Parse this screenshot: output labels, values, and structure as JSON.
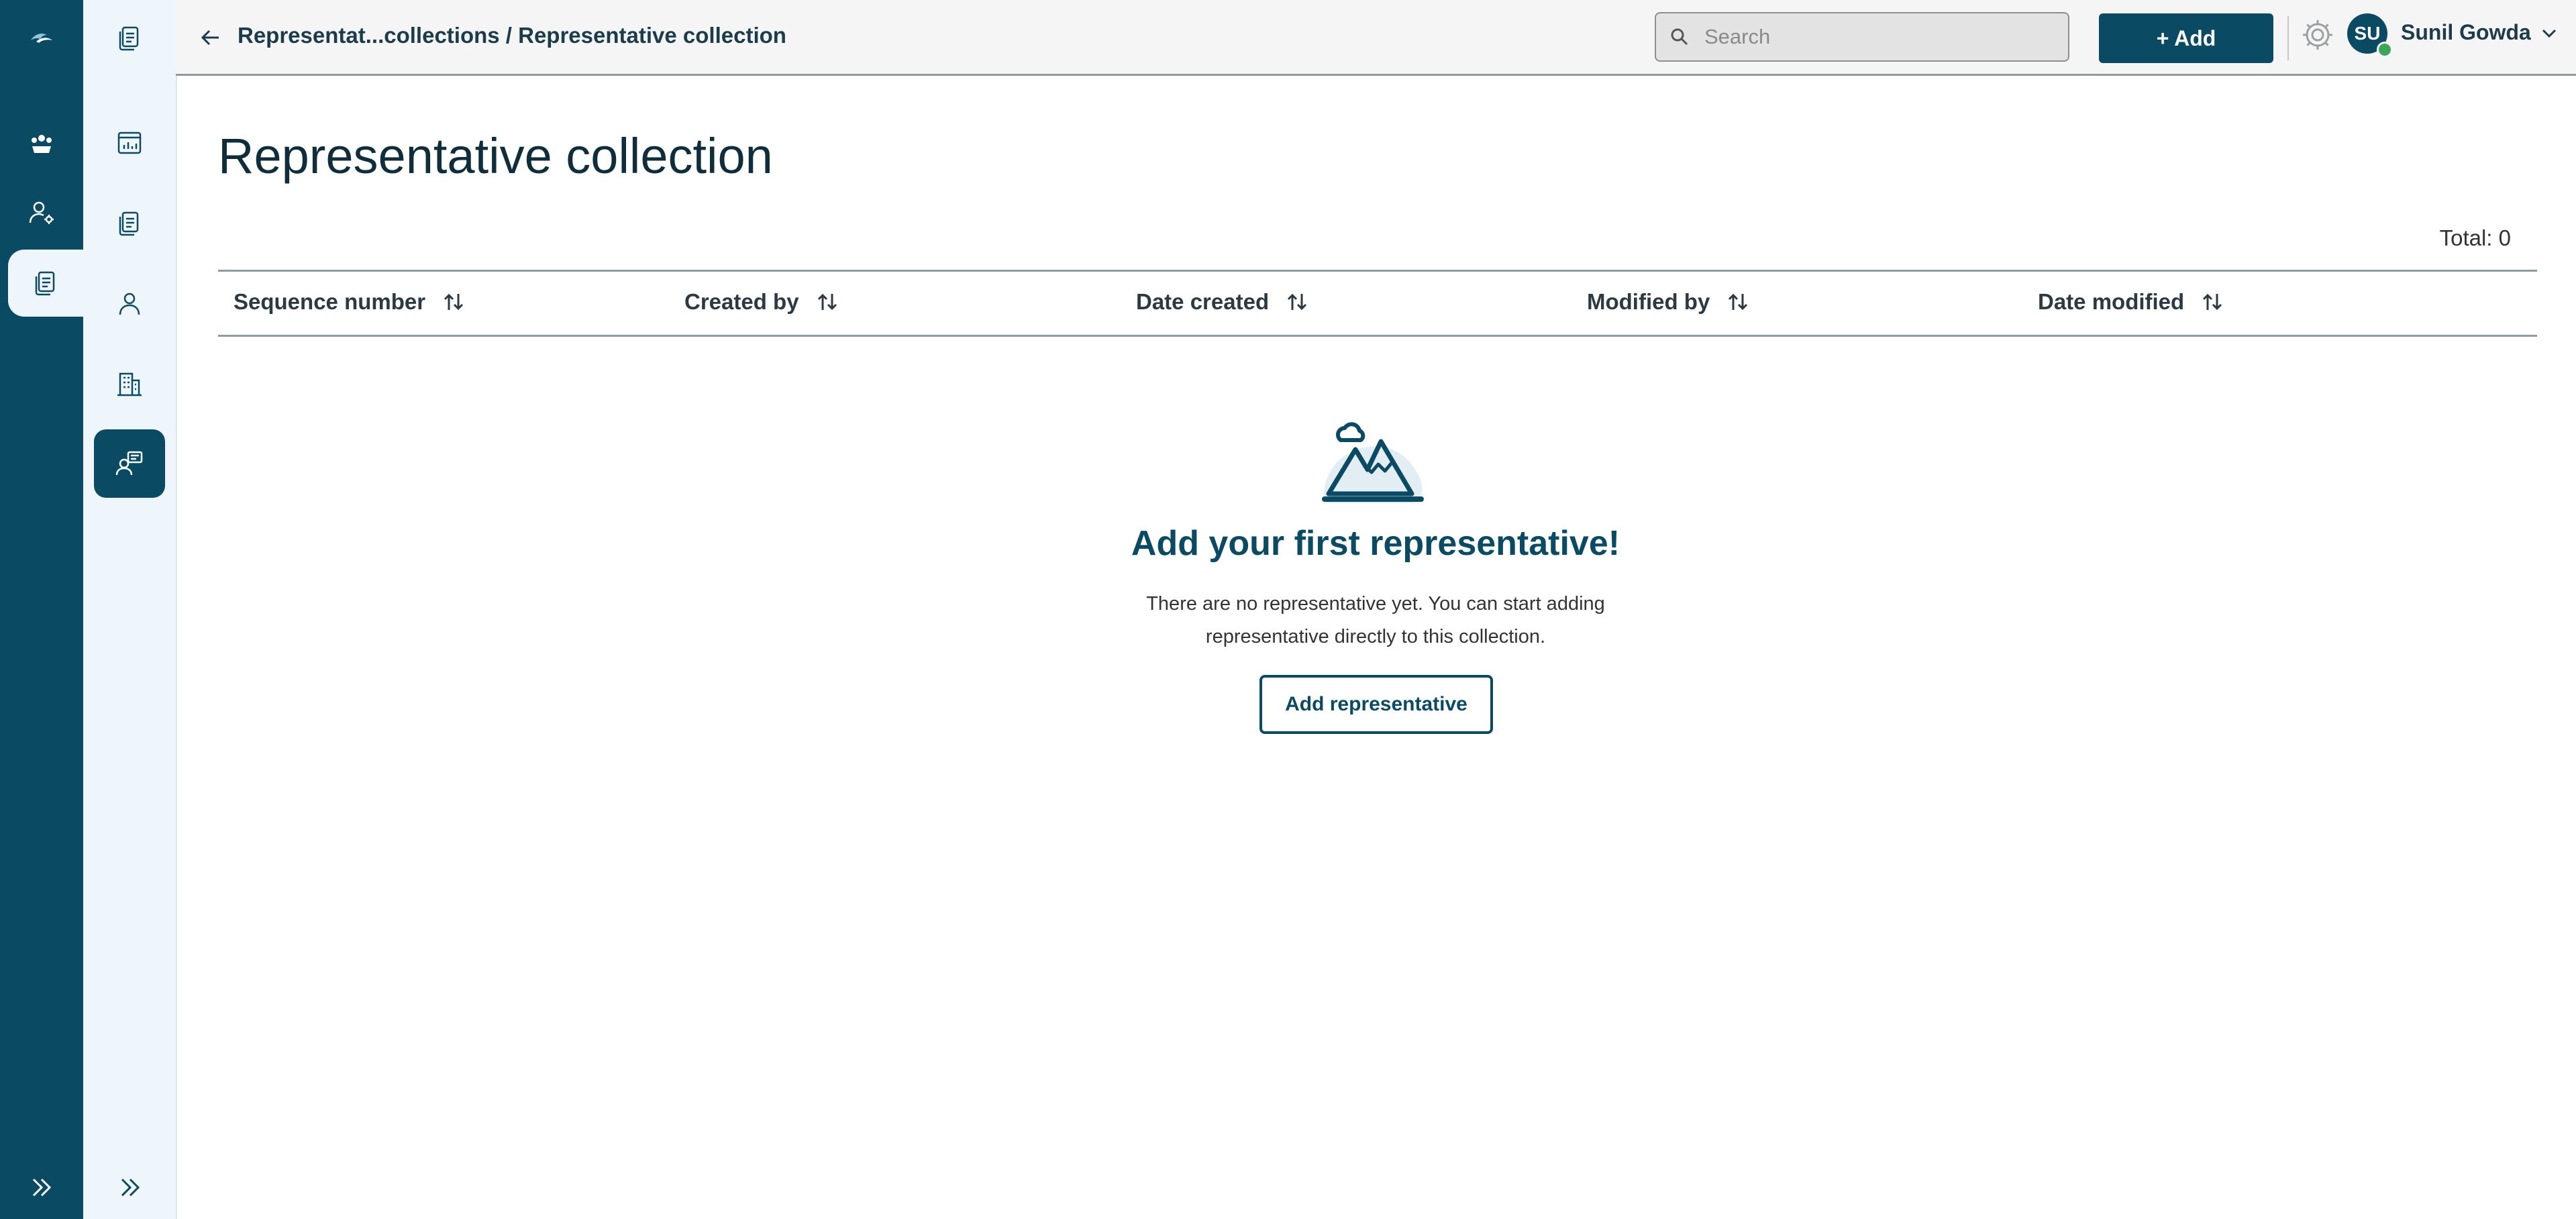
{
  "header": {
    "breadcrumb": "Representat...collections / Representative collection",
    "search_placeholder": "Search",
    "add_label": "+ Add",
    "user_initials": "SU",
    "user_name": "Sunil Gowda"
  },
  "page": {
    "title": "Representative collection",
    "total": "Total: 0"
  },
  "table": {
    "columns": [
      "Sequence number",
      "Created by",
      "Date created",
      "Modified by",
      "Date modified"
    ]
  },
  "empty_state": {
    "title": "Add your first representative!",
    "line1": "There are no representative yet. You can start adding",
    "line2": "representative directly to this collection.",
    "button": "Add representative"
  },
  "icons": {
    "rail": [
      "logo-icon",
      "team-icon",
      "user-settings-icon",
      "documents-icon",
      "expand-icon"
    ],
    "sub": [
      "documents-icon",
      "dashboard-icon",
      "documents-icon",
      "person-icon",
      "building-icon",
      "representative-icon",
      "expand-icon"
    ]
  },
  "colors": {
    "brand": "#0b4a63",
    "rail_bg": "#0b4a63",
    "subbar_bg": "#eef6fc",
    "presence": "#3aa657"
  }
}
